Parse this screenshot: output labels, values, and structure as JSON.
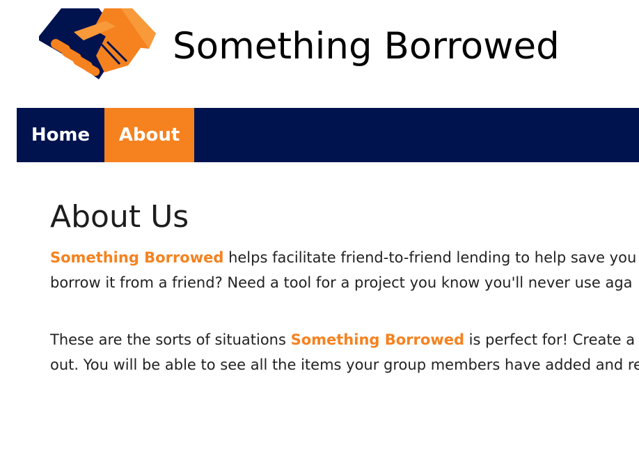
{
  "header": {
    "logo_alt": "handshake-logo",
    "site_title": "Something Borrowed"
  },
  "nav": {
    "items": [
      {
        "label": "Home",
        "active": false
      },
      {
        "label": "About",
        "active": true
      }
    ]
  },
  "main": {
    "heading": "About Us",
    "paragraph1": {
      "brand": "Something Borrowed",
      "line1_rest": " helps facilitate friend-to-friend lending to help save you ",
      "line2": "borrow it from a friend? Need a tool for a project you know you'll never use aga"
    },
    "paragraph2": {
      "line1_pre": "These are the sorts of situations ",
      "brand": "Something Borrowed",
      "line1_post": " is perfect for! Create a fr",
      "line2": "out. You will be able to see all the items your group members have added and re"
    }
  },
  "colors": {
    "navy": "#00134f",
    "orange": "#f5821f",
    "light_orange": "#f89a3a"
  }
}
